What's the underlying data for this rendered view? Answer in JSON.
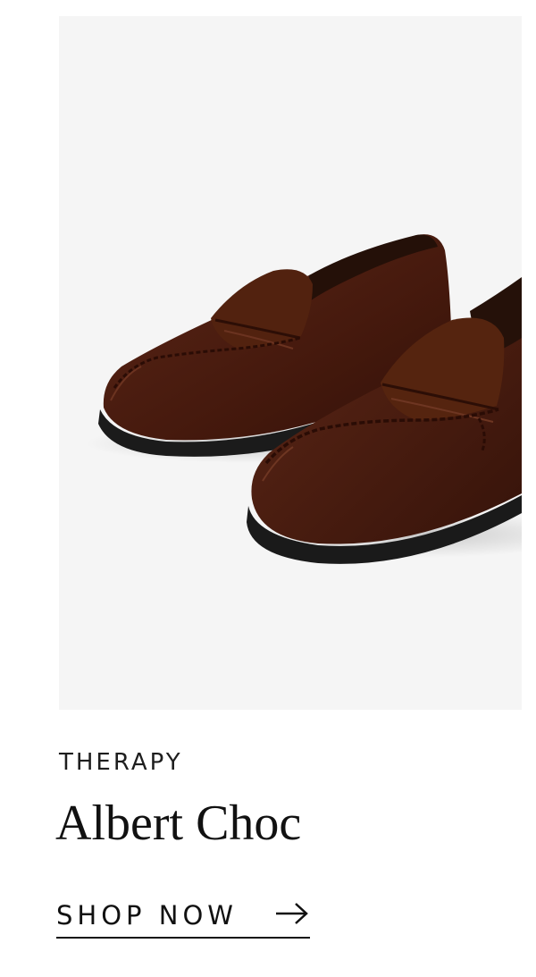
{
  "product": {
    "image_description_icon": "loafer-shoes-image",
    "brand": "THERAPY",
    "name": "Albert Choc",
    "cta_label": "SHOP NOW",
    "cta_icon": "arrow-right-icon"
  },
  "colors": {
    "image_background": "#f5f5f5",
    "shoe_suede": "#4a1d10",
    "sole": "#1a1a1a",
    "text": "#111111"
  }
}
